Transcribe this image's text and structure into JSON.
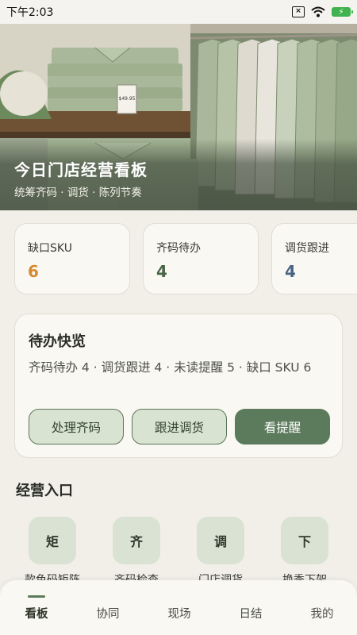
{
  "status_bar": {
    "time": "下午2:03",
    "battery_level": 1.0
  },
  "hero": {
    "title": "今日门店经营看板",
    "subtitle": "统筹齐码 · 调货 · 陈列节奏",
    "price_tag": "$49.95"
  },
  "stats": [
    {
      "label": "缺口SKU",
      "value": "6",
      "color": "#d58a2f"
    },
    {
      "label": "齐码待办",
      "value": "4",
      "color": "#4a6446"
    },
    {
      "label": "调货跟进",
      "value": "4",
      "color": "#4a6583"
    }
  ],
  "todo": {
    "title": "待办快览",
    "summary": "齐码待办 4 · 调货跟进 4 · 未读提醒 5 · 缺口 SKU 6",
    "buttons": [
      "处理齐码",
      "跟进调货",
      "看提醒"
    ]
  },
  "entries": {
    "title": "经营入口",
    "items": [
      {
        "icon": "矩",
        "label": "款色码矩阵"
      },
      {
        "icon": "齐",
        "label": "齐码检查"
      },
      {
        "icon": "调",
        "label": "门店调货"
      },
      {
        "icon": "下",
        "label": "换季下架"
      }
    ]
  },
  "tabs": [
    "看板",
    "协同",
    "现场",
    "日结",
    "我的"
  ],
  "colors": {
    "accent": "#5c7a5c",
    "card_bg": "#faf8f3",
    "page_bg": "#f2efe9"
  }
}
